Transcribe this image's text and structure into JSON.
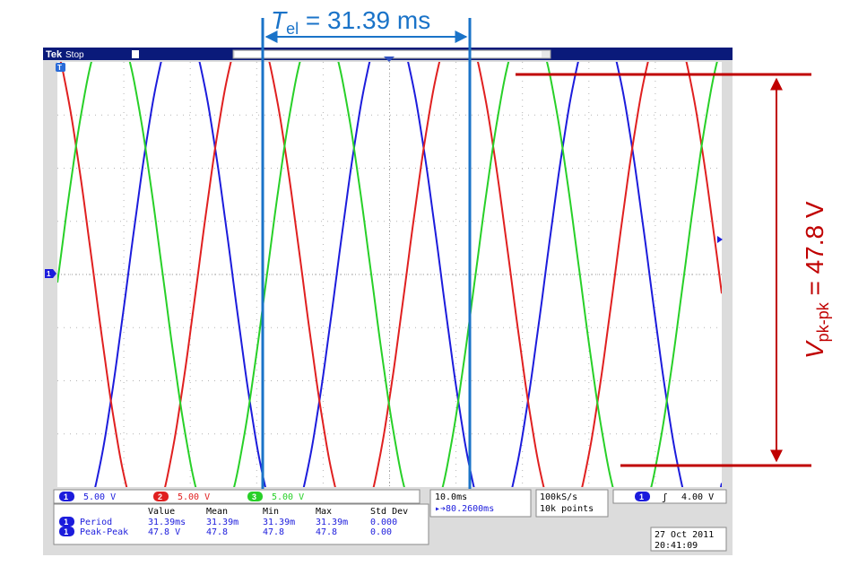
{
  "scope": {
    "logo": "Tek",
    "run_state": "Stop",
    "trigger_marker": "T",
    "channel_ground_marker": "1",
    "channels": [
      {
        "id": "1",
        "scale": "5.00 V",
        "color": "#1c1cdc"
      },
      {
        "id": "2",
        "scale": "5.00 V",
        "color": "#e02020"
      },
      {
        "id": "3",
        "scale": "5.00 V",
        "color": "#28d028"
      }
    ],
    "measurements": {
      "headers": [
        "Value",
        "Mean",
        "Min",
        "Max",
        "Std Dev"
      ],
      "rows": [
        {
          "ch": "1",
          "name": "Period",
          "value": "31.39ms",
          "mean": "31.39m",
          "min": "31.39m",
          "max": "31.39m",
          "std": "0.000"
        },
        {
          "ch": "1",
          "name": "Peak-Peak",
          "value": "47.8 V",
          "mean": "47.8",
          "min": "47.8",
          "max": "47.8",
          "std": "0.00"
        }
      ]
    },
    "timebase": {
      "scale": "10.0ms",
      "position": "▸➔80.2600ms"
    },
    "acquisition": {
      "rate": "100kS/s",
      "record": "10k points"
    },
    "trigger": {
      "source": "1",
      "slope": "ʃ",
      "level": "4.00 V"
    },
    "date": "27 Oct  2011",
    "time": "20:41:09"
  },
  "annotations": {
    "period": {
      "var": "T",
      "sub": "el",
      "text": " = 31.39 ms",
      "color": "#1a73c8"
    },
    "peak": {
      "var": "V",
      "sub": "pk-pk",
      "text": " = 47.8 V",
      "color": "#c00000"
    }
  },
  "chart_data": {
    "type": "line",
    "title": "",
    "xlabel": "",
    "ylabel": "",
    "x_units": "ms",
    "xlim": [
      -50,
      50
    ],
    "ylim": [
      -20,
      20
    ],
    "grid": true,
    "series": [
      {
        "name": "",
        "color": "#1c1cdc",
        "amplitude": 23.9,
        "period": 31.39,
        "first_peak_x": -31.5
      },
      {
        "name": "",
        "color": "#e02020",
        "amplitude": 23.9,
        "period": 31.39,
        "first_peak_x": -21.0
      },
      {
        "name": "",
        "color": "#28d028",
        "amplitude": 23.9,
        "period": 31.39,
        "first_peak_x": -10.6
      }
    ]
  }
}
